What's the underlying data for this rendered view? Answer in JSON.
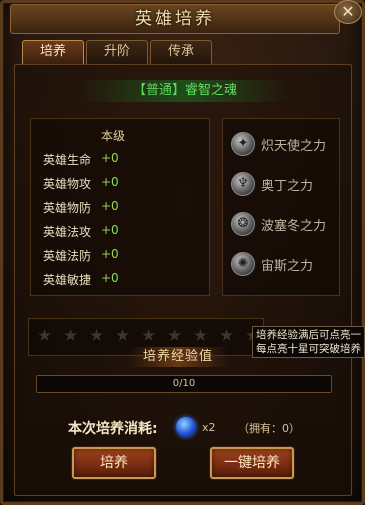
{
  "window": {
    "title": "英雄培养",
    "close_symbol": "✕"
  },
  "tabs": [
    {
      "label": "培养",
      "active": true
    },
    {
      "label": "升阶",
      "active": false
    },
    {
      "label": "传承",
      "active": false
    }
  ],
  "hero": {
    "tier": "【普通】",
    "name": "睿智之魂"
  },
  "stats": {
    "header": "本级",
    "rows": [
      {
        "label": "英雄生命",
        "value": "+0"
      },
      {
        "label": "英雄物攻",
        "value": "+0"
      },
      {
        "label": "英雄物防",
        "value": "+0"
      },
      {
        "label": "英雄法攻",
        "value": "+0"
      },
      {
        "label": "英雄法防",
        "value": "+0"
      },
      {
        "label": "英雄敏捷",
        "value": "+0"
      }
    ]
  },
  "powers": [
    {
      "label": "炽天使之力",
      "icon": "angel-emblem-icon"
    },
    {
      "label": "奥丁之力",
      "icon": "odin-emblem-icon"
    },
    {
      "label": "波塞冬之力",
      "icon": "poseidon-emblem-icon"
    },
    {
      "label": "宙斯之力",
      "icon": "zeus-emblem-icon"
    }
  ],
  "stars": {
    "total": 10,
    "filled": 0
  },
  "tooltip": {
    "line1": "培养经验满后可点亮一",
    "line2": "每点亮十星可突破培养"
  },
  "experience": {
    "title": "培养经验值",
    "current": 0,
    "max": 10,
    "text": "0/10"
  },
  "cost": {
    "label": "本次培养消耗:",
    "icon": "blue-orb-icon",
    "qty": "x2",
    "owned": "（拥有：0）"
  },
  "buttons": {
    "train": "培养",
    "one_click": "一键培养"
  },
  "colors": {
    "accent_green": "#5cd65c",
    "stat_value": "#8fd65a",
    "button_red": "#a0421e",
    "gold_border": "#c79a52"
  }
}
